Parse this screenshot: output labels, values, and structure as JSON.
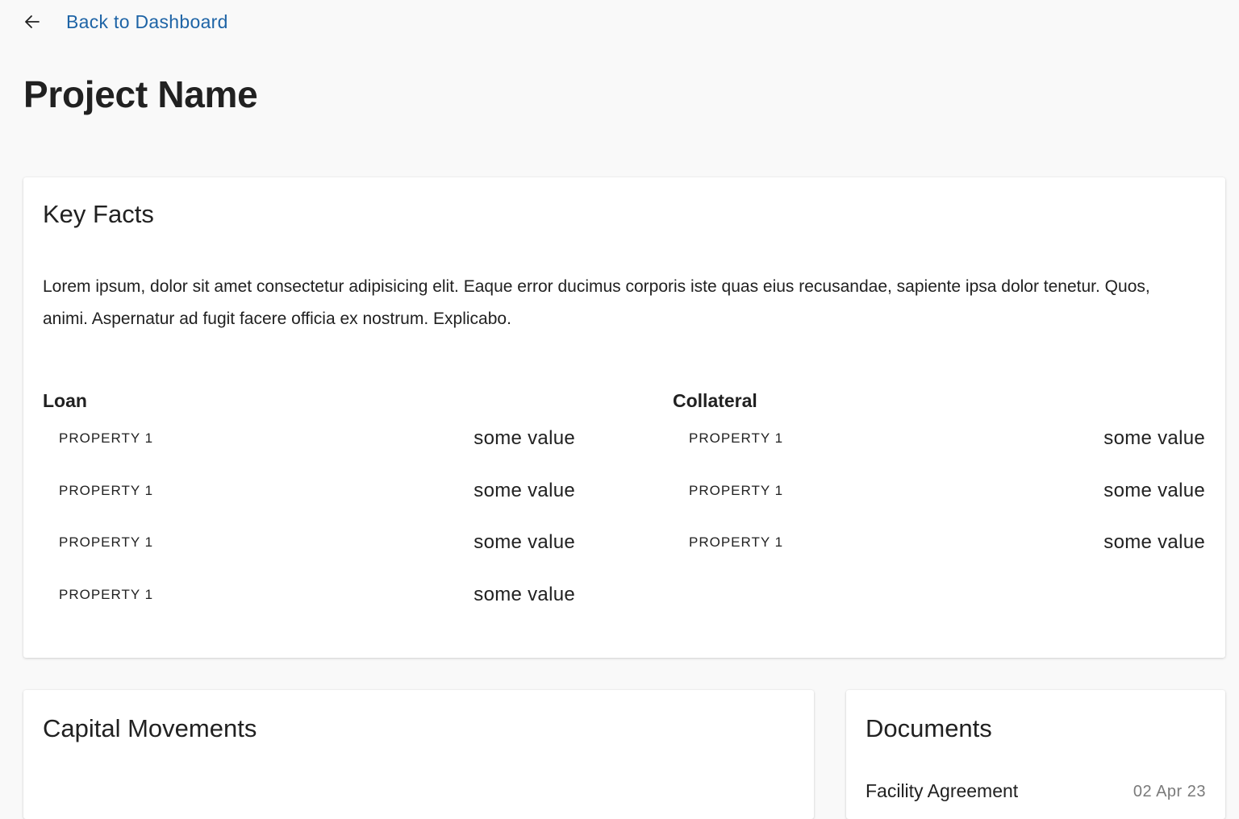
{
  "nav": {
    "back_label": "Back to Dashboard",
    "back_icon": "arrow-left-icon"
  },
  "page": {
    "title": "Project Name"
  },
  "key_facts": {
    "title": "Key Facts",
    "description": "Lorem ipsum, dolor sit amet consectetur adipisicing elit. Eaque error ducimus corporis iste quas eius recusandae, sapiente ipsa dolor tenetur. Quos, animi. Aspernatur ad fugit facere officia ex nostrum. Explicabo.",
    "loan": {
      "title": "Loan",
      "rows": [
        {
          "label": "PROPERTY 1",
          "value": "some value"
        },
        {
          "label": "PROPERTY 1",
          "value": "some value"
        },
        {
          "label": "PROPERTY 1",
          "value": "some value"
        },
        {
          "label": "PROPERTY 1",
          "value": "some value"
        }
      ]
    },
    "collateral": {
      "title": "Collateral",
      "rows": [
        {
          "label": "PROPERTY 1",
          "value": "some value"
        },
        {
          "label": "PROPERTY 1",
          "value": "some value"
        },
        {
          "label": "PROPERTY 1",
          "value": "some value"
        }
      ]
    }
  },
  "capital_movements": {
    "title": "Capital Movements"
  },
  "documents": {
    "title": "Documents",
    "items": [
      {
        "name": "Facility Agreement",
        "date": "02 Apr 23"
      }
    ]
  },
  "colors": {
    "link": "#1e64a6",
    "background": "#f9f9f9",
    "card": "#ffffff",
    "text": "#212121",
    "muted": "#7a7a7a"
  }
}
